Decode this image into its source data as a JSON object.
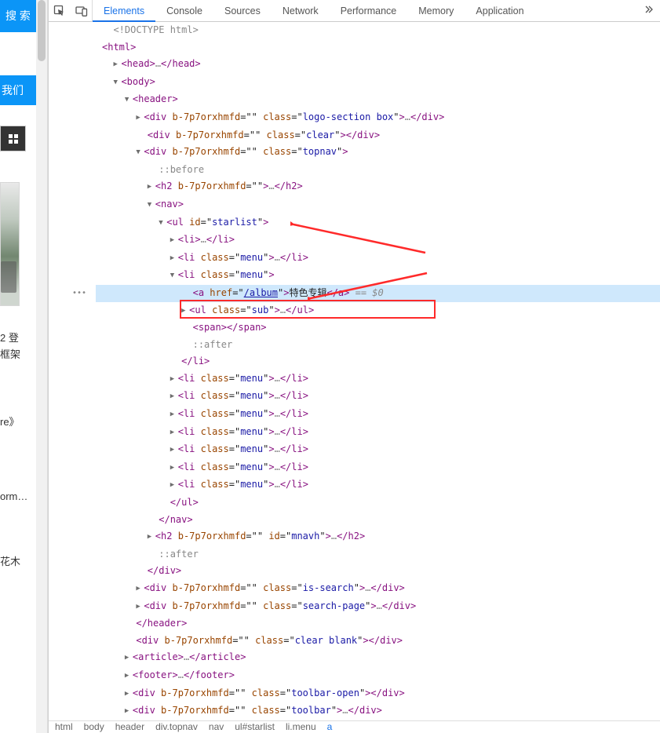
{
  "left": {
    "search": "搜 索",
    "contact": "我们",
    "txt1a": "2 登",
    "txt1b": "框架",
    "txt2": "re》",
    "txt3": "orm…",
    "txt4": "花木"
  },
  "tabs": [
    "Elements",
    "Console",
    "Sources",
    "Network",
    "Performance",
    "Memory",
    "Application"
  ],
  "active_tab": 0,
  "code": {
    "doctype": "<!DOCTYPE html>",
    "html_open": "html",
    "head_open": "head",
    "head_close": "head",
    "body_open": "body",
    "header_open": "header",
    "div1_attr": "b-7p7orxhmfd",
    "div1_cls": "logo-section box",
    "div2_cls": "clear",
    "div3_cls": "topnav",
    "before": "::before",
    "h2_attr": "b-7p7orxhmfd",
    "nav": "nav",
    "ul_id": "starlist",
    "li": "li",
    "menu_cls": "menu",
    "a_href": "/album",
    "a_text": "特色专辑",
    "sel_var": "== $0",
    "ul_sub_cls": "sub",
    "span": "span",
    "after": "::after",
    "mnavh_id": "mnavh",
    "is_search_cls": "is-search",
    "search_page_cls": "search-page",
    "clear_blank_cls": "clear blank",
    "article": "article",
    "footer": "footer",
    "toolbar_open_cls": "toolbar-open",
    "toolbar_cls": "toolbar"
  },
  "crumbs": [
    "html",
    "body",
    "header",
    "div.topnav",
    "nav",
    "ul#starlist",
    "li.menu",
    "a"
  ]
}
